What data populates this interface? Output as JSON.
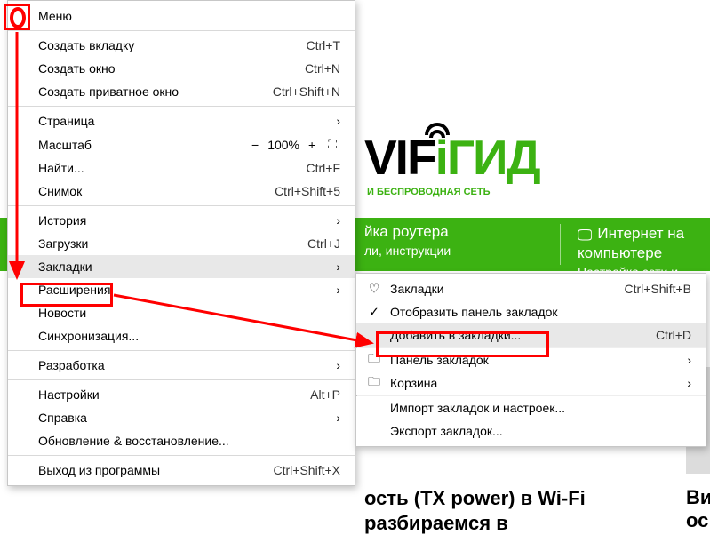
{
  "menu": {
    "header": "Меню",
    "items": [
      {
        "label": "Создать вкладку",
        "shortcut": "Ctrl+T"
      },
      {
        "label": "Создать окно",
        "shortcut": "Ctrl+N"
      },
      {
        "label": "Создать приватное окно",
        "shortcut": "Ctrl+Shift+N"
      }
    ],
    "page": {
      "label": "Страница"
    },
    "zoom": {
      "label": "Масштаб",
      "value": "100%"
    },
    "find": {
      "label": "Найти...",
      "shortcut": "Ctrl+F"
    },
    "snapshot": {
      "label": "Снимок",
      "shortcut": "Ctrl+Shift+5"
    },
    "history": {
      "label": "История"
    },
    "downloads": {
      "label": "Загрузки",
      "shortcut": "Ctrl+J"
    },
    "bookmarks": {
      "label": "Закладки"
    },
    "extensions": {
      "label": "Расширения"
    },
    "news": {
      "label": "Новости"
    },
    "sync": {
      "label": "Синхронизация..."
    },
    "dev": {
      "label": "Разработка"
    },
    "settings": {
      "label": "Настройки",
      "shortcut": "Alt+P"
    },
    "help": {
      "label": "Справка"
    },
    "update": {
      "label": "Обновление & восстановление..."
    },
    "exit": {
      "label": "Выход из программы",
      "shortcut": "Ctrl+Shift+X"
    }
  },
  "submenu": {
    "bookmarks": {
      "label": "Закладки",
      "shortcut": "Ctrl+Shift+B"
    },
    "showbar": {
      "label": "Отобразить панель закладок"
    },
    "add": {
      "label": "Добавить в закладки...",
      "shortcut": "Ctrl+D"
    },
    "panel": {
      "label": "Панель закладок"
    },
    "trash": {
      "label": "Корзина"
    },
    "import": {
      "label": "Импорт закладок и настроек..."
    },
    "export": {
      "label": "Экспорт закладок..."
    }
  },
  "page": {
    "logo_sub": "И БЕСПРОВОДНАЯ СЕТЬ",
    "nav1_title": "йка роутера",
    "nav1_sub": "ли, инструкции",
    "nav2_title": "Интернет на компьютере",
    "nav2_sub": "Настройка сети и ошибки",
    "article1_a": "ость (TX power) в Wi-Fi",
    "article1_b": "разбираемся в",
    "article2_a": "Ви",
    "article2_b": "ос"
  },
  "icons": {
    "chevron": "›",
    "heart": "♡",
    "folder": "🗀",
    "monitor": "🖵"
  }
}
